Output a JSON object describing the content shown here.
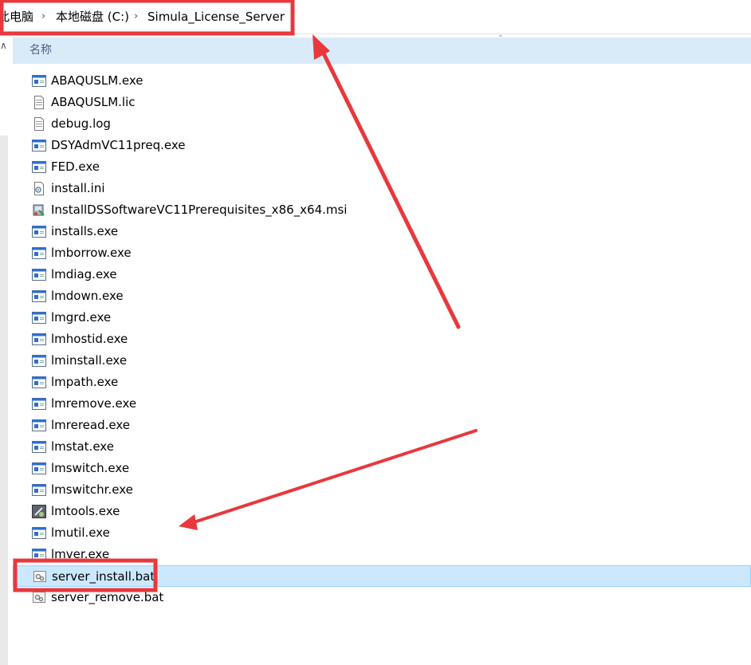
{
  "breadcrumb": {
    "items": [
      "此电脑",
      "本地磁盘 (C:)",
      "Simula_License_Server"
    ]
  },
  "columns": {
    "name": "名称"
  },
  "files": [
    {
      "name": "ABAQUSLM.exe",
      "icon": "exe-icon"
    },
    {
      "name": "ABAQUSLM.lic",
      "icon": "text-file-icon"
    },
    {
      "name": "debug.log",
      "icon": "text-file-icon"
    },
    {
      "name": "DSYAdmVC11preq.exe",
      "icon": "exe-icon"
    },
    {
      "name": "FED.exe",
      "icon": "exe-icon"
    },
    {
      "name": "install.ini",
      "icon": "settings-file-icon"
    },
    {
      "name": "InstallDSSoftwareVC11Prerequisites_x86_x64.msi",
      "icon": "msi-installer-icon"
    },
    {
      "name": "installs.exe",
      "icon": "exe-icon"
    },
    {
      "name": "lmborrow.exe",
      "icon": "exe-icon"
    },
    {
      "name": "lmdiag.exe",
      "icon": "exe-icon"
    },
    {
      "name": "lmdown.exe",
      "icon": "exe-icon"
    },
    {
      "name": "lmgrd.exe",
      "icon": "exe-icon"
    },
    {
      "name": "lmhostid.exe",
      "icon": "exe-icon"
    },
    {
      "name": "lminstall.exe",
      "icon": "exe-icon"
    },
    {
      "name": "lmpath.exe",
      "icon": "exe-icon"
    },
    {
      "name": "lmremove.exe",
      "icon": "exe-icon"
    },
    {
      "name": "lmreread.exe",
      "icon": "exe-icon"
    },
    {
      "name": "lmstat.exe",
      "icon": "exe-icon"
    },
    {
      "name": "lmswitch.exe",
      "icon": "exe-icon"
    },
    {
      "name": "lmswitchr.exe",
      "icon": "exe-icon"
    },
    {
      "name": "lmtools.exe",
      "icon": "lmtools-icon"
    },
    {
      "name": "lmutil.exe",
      "icon": "exe-icon"
    },
    {
      "name": "lmver.exe",
      "icon": "exe-icon"
    },
    {
      "name": "server_install.bat",
      "icon": "batch-file-icon",
      "selected": true
    },
    {
      "name": "server_remove.bat",
      "icon": "batch-file-icon"
    }
  ],
  "colors": {
    "annotation": "#e8383d",
    "selection": "#cce8ff",
    "header": "#d9ebf9"
  }
}
